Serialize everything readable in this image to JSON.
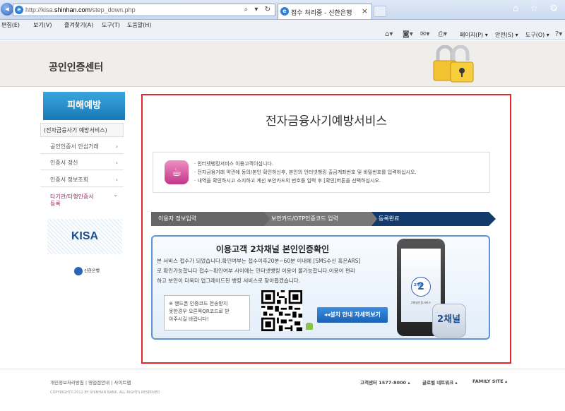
{
  "browser": {
    "url_base": "http://kisa.",
    "url_domain": "shinhan.com",
    "url_path": "/step_down.php",
    "addr_icons": "⌕ ▾ ↻",
    "tab_title": "접수 처리중 - 신한은행",
    "tab_close": "×",
    "window_icons": "⌂ ☆ ⚙",
    "menu": [
      "편집(E)",
      "보기(V)",
      "즐겨찾기(A)",
      "도구(T)",
      "도움말(H)"
    ],
    "commands": [
      "페이지(P) ▾",
      "안전(S) ▾",
      "도구(O) ▾"
    ]
  },
  "header": {
    "site_title": "공인인증센터"
  },
  "sidebar": {
    "title": "피해예방",
    "items": [
      {
        "label": "(전자금융사기 예방서비스)"
      },
      {
        "label": "공인인증서 안심거래"
      },
      {
        "label": "인증서 갱신"
      },
      {
        "label": "인증서 정보조회"
      },
      {
        "label": "타기관/타행인증서",
        "label2": "등록"
      }
    ],
    "kisa": "KISA",
    "bank_logo": "신한은행"
  },
  "main": {
    "title": "전자금융사기예방서비스",
    "info_lines": [
      "· 인터넷뱅킹서비스 이용고객이십니다.",
      "· 전자금융거래 약관에 동의/본인 확인하신후, 본인의 인터넷뱅킹 출금계좌번호 및 비밀번호를 입력하십시오.",
      "· 내역을 확인하시고 소지하고 계신 보안카드의 번호를 입력 후 [확인]버튼을 선택하십시오."
    ],
    "steps": [
      "이용자 정보입력",
      "보안카드/OTP인증코드 입력",
      "등록완료"
    ],
    "channel": {
      "title": "이용고객 2차채널 본인인증확인",
      "desc": [
        "본 서비스 접수가 되었습니다.확인여부는 접수이후20분~60분 이내에 [SMS수신 혹은ARS]",
        "로 확인가능합니다 접수~확인여부 사이에는 인터넷뱅킹 이용이 불가능합니다.이용이 편리",
        "하고 보안이 더욱더 업그레이드된 뱅킹 서비스로 찾아뵙겠습니다."
      ],
      "note": [
        "※ 핸드폰 인증코드 전송받지",
        "못한경우 오른쪽QR코드로 받",
        "아주시길 바랍니다!"
      ],
      "install_button": "◂◂설치 안내 자세히보기",
      "phone_logo": "2",
      "phone_text": "2채널",
      "phone_sub": "2채널인증서비스",
      "tile_text": "2채널"
    }
  },
  "footer": {
    "links": "개인정보처리방침 | 영업점안내 | 사이트맵",
    "copyright": "COPYRIGHT©2012 BY SHINHAN BANK. ALL RIGHTS RESERVED",
    "customer_center": "고객센터  1577-8000 ▴",
    "network": "글로벌 네트워크 ▴",
    "family": "FAMILY SITE ▴"
  },
  "colors": {
    "red_border": "#e2262c",
    "sidebar_blue": "#1878b8",
    "step_active": "#123a6b",
    "channel_border": "#5b96d2"
  }
}
